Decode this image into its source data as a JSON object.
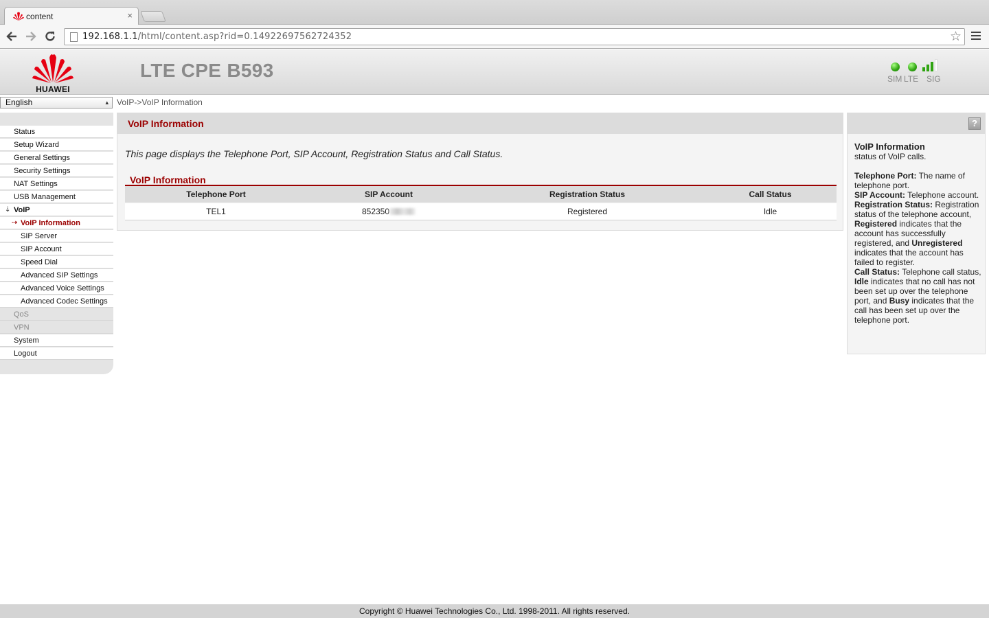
{
  "browser": {
    "tab_title": "content",
    "tab_close": "×",
    "url_host": "192.168.1.1",
    "url_path": "/html/content.asp?rid=0.14922697562724352"
  },
  "header": {
    "logo_text": "HUAWEI",
    "product": "LTE CPE B593",
    "status_labels": {
      "sim": "SIM",
      "lte": "LTE",
      "sig": "SIG"
    },
    "led_color": "#2fa411",
    "signal_bars_active": 3,
    "signal_bars_total": 4
  },
  "language": {
    "selected": "English"
  },
  "breadcrumb": "VoIP->VoIP Information",
  "sidebar": {
    "items": [
      {
        "label": "Status"
      },
      {
        "label": "Setup Wizard"
      },
      {
        "label": "General Settings"
      },
      {
        "label": "Security Settings"
      },
      {
        "label": "NAT Settings"
      },
      {
        "label": "USB Management"
      },
      {
        "label": "VoIP"
      },
      {
        "label": "VoIP Information"
      },
      {
        "label": "SIP Server"
      },
      {
        "label": "SIP Account"
      },
      {
        "label": "Speed Dial"
      },
      {
        "label": "Advanced SIP Settings"
      },
      {
        "label": "Advanced Voice Settings"
      },
      {
        "label": "Advanced Codec Settings"
      },
      {
        "label": "QoS"
      },
      {
        "label": "VPN"
      },
      {
        "label": "System"
      },
      {
        "label": "Logout"
      }
    ]
  },
  "main": {
    "title": "VoIP Information",
    "description": "This page displays the Telephone Port, SIP Account, Registration Status and Call Status.",
    "section_title": "VoIP Information",
    "table": {
      "headers": [
        "Telephone Port",
        "SIP Account",
        "Registration Status",
        "Call Status"
      ],
      "rows": [
        {
          "port": "TEL1",
          "sip_account": "852350",
          "registration": "Registered",
          "call_status": "Idle"
        }
      ]
    }
  },
  "help": {
    "icon": "?",
    "title": "VoIP Information",
    "intro": "status of VoIP calls.",
    "tp_label": "Telephone Port:",
    "tp_text": " The name of telephone port.",
    "sa_label": "SIP Account:",
    "sa_text": " Telephone account.",
    "rs_label": "Registration Status:",
    "rs_text1": " Registration status of the telephone account, ",
    "rs_registered": "Registered",
    "rs_text2": " indicates that the account has successfully registered, and ",
    "rs_unregistered": "Unregistered",
    "rs_text3": " indicates that the account has failed to register.",
    "cs_label": "Call Status:",
    "cs_text1": " Telephone call status, ",
    "cs_idle": "Idle",
    "cs_text2": " indicates that no call has not been set up over the telephone port, and ",
    "cs_busy": "Busy",
    "cs_text3": " indicates that the call has been set up over the telephone port."
  },
  "footer": "Copyright © Huawei Technologies Co., Ltd. 1998-2011. All rights reserved.",
  "colors": {
    "accent": "#9b0000",
    "logo_red": "#e60012"
  }
}
